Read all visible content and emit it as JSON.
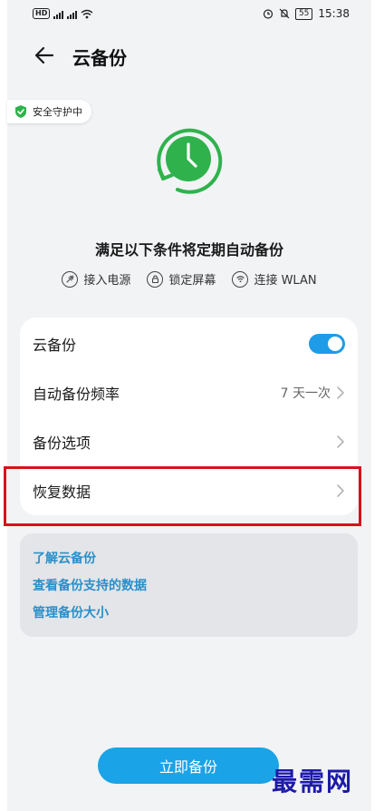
{
  "status_bar": {
    "hd_label": "HD",
    "network_labels": [
      "4G",
      "4G"
    ],
    "battery": "55",
    "time": "15:38"
  },
  "header": {
    "title": "云备份"
  },
  "security_badge": {
    "label": "安全守护中"
  },
  "conditions": {
    "title": "满足以下条件将定期自动备份",
    "items": [
      {
        "icon": "plug-icon",
        "label": "接入电源"
      },
      {
        "icon": "lock-icon",
        "label": "锁定屏幕"
      },
      {
        "icon": "wifi-icon",
        "label": "连接 WLAN"
      }
    ]
  },
  "settings": {
    "cloud_backup": {
      "label": "云备份",
      "enabled": true
    },
    "frequency": {
      "label": "自动备份频率",
      "value": "7 天一次"
    },
    "options": {
      "label": "备份选项"
    },
    "restore": {
      "label": "恢复数据"
    }
  },
  "links": [
    {
      "label": "了解云备份"
    },
    {
      "label": "查看备份支持的数据"
    },
    {
      "label": "管理备份大小"
    }
  ],
  "backup_button": {
    "label": "立即备份"
  },
  "watermark": {
    "text": "最需网"
  },
  "colors": {
    "accent": "#1aa3e6",
    "green": "#2fb24c",
    "highlight": "#d6121b"
  }
}
